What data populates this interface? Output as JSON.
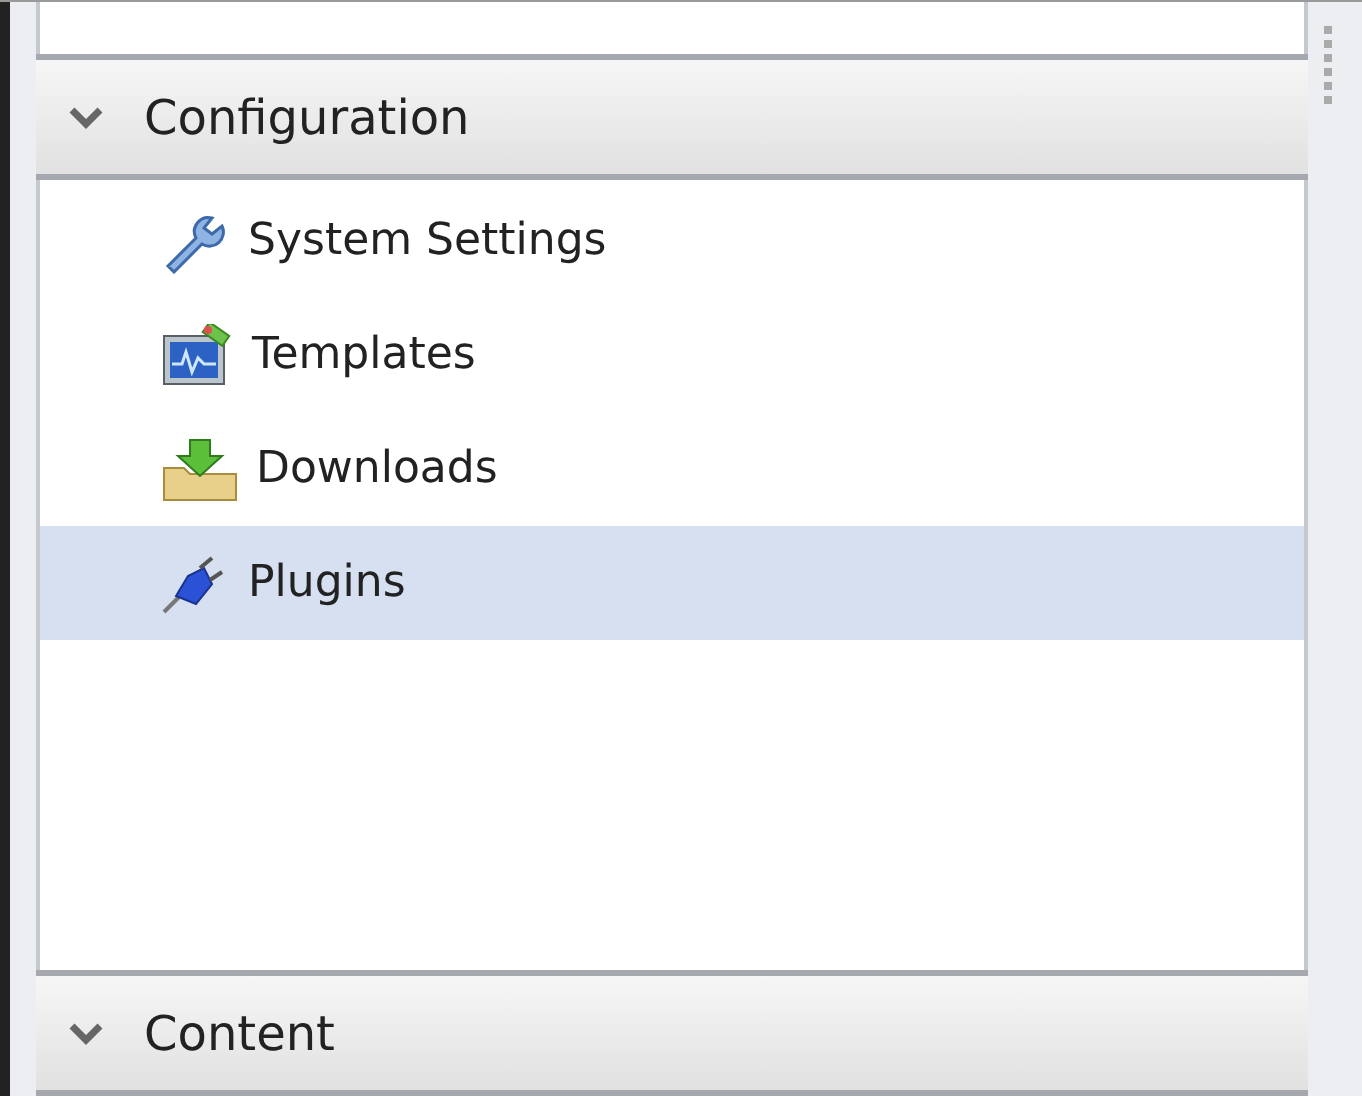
{
  "sections": [
    {
      "title": "Configuration",
      "items": [
        {
          "label": "System Settings",
          "kind": "wrench",
          "selected": false
        },
        {
          "label": "Templates",
          "kind": "chart",
          "selected": false
        },
        {
          "label": "Downloads",
          "kind": "download",
          "selected": false
        },
        {
          "label": "Plugins",
          "kind": "plug",
          "selected": true
        }
      ]
    },
    {
      "title": "Content"
    }
  ]
}
